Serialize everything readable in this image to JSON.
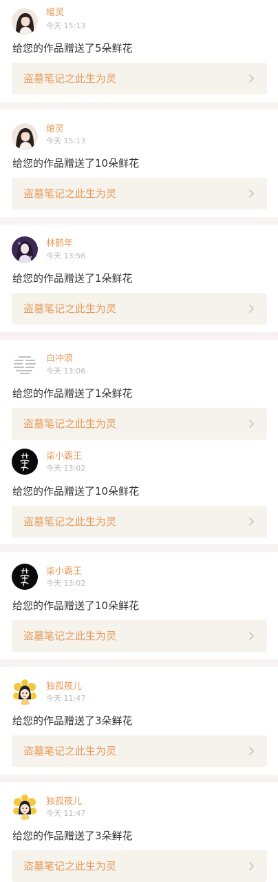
{
  "notifications": [
    {
      "username": "绾灵",
      "time": "今天 15:13",
      "message": "给您的作品赠送了5朵鲜花",
      "work_title": "盗墓笔记之此生为灵",
      "avatar": "girl-dark-hair"
    },
    {
      "username": "绾灵",
      "time": "今天 15:13",
      "message": "给您的作品赠送了10朵鲜花",
      "work_title": "盗墓笔记之此生为灵",
      "avatar": "girl-dark-hair"
    },
    {
      "username": "林鹤年",
      "time": "今天 13:56",
      "message": "给您的作品赠送了1朵鲜花",
      "work_title": "盗墓笔记之此生为灵",
      "avatar": "girl-purple"
    },
    {
      "username": "白冲浪",
      "time": "今天 13:06",
      "message": "给您的作品赠送了1朵鲜花",
      "work_title": "盗墓笔记之此生为灵",
      "avatar": "text-note"
    },
    {
      "username": "柒小霸王",
      "time": "今天 13:02",
      "message": "给您的作品赠送了10朵鲜花",
      "work_title": "盗墓笔记之此生为灵",
      "avatar": "black-calligraphy"
    },
    {
      "username": "柒小霸王",
      "time": "今天 13:02",
      "message": "给您的作品赠送了10朵鲜花",
      "work_title": "盗墓笔记之此生为灵",
      "avatar": "black-calligraphy"
    },
    {
      "username": "独孤筱儿",
      "time": "今天 11:47",
      "message": "给您的作品赠送了3朵鲜花",
      "work_title": "盗墓笔记之此生为灵",
      "avatar": "cartoon-flower-girl"
    },
    {
      "username": "独孤筱儿",
      "time": "今天 11:47",
      "message": "给您的作品赠送了3朵鲜花",
      "work_title": "盗墓笔记之此生为灵",
      "avatar": "cartoon-flower-girl"
    }
  ],
  "colors": {
    "username": "#e89a5b",
    "work_title": "#e89a5b",
    "card_bg": "#f5f3ec",
    "timestamp": "#b9b9b9",
    "message": "#333333",
    "separator": "#f7f3f3"
  }
}
